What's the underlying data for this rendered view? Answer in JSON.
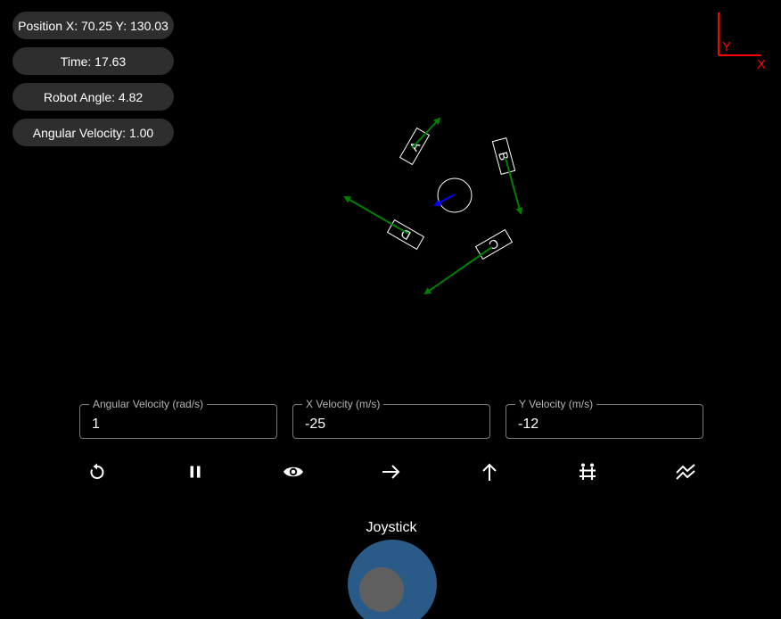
{
  "status": {
    "position": "Position X: 70.25 Y: 130.03",
    "time": "Time: 17.63",
    "robot_angle": "Robot Angle: 4.82",
    "angular_velocity": "Angular Velocity: 1.00"
  },
  "axes_indicator": {
    "y_label": "Y",
    "x_label": "X",
    "color": "#ff0000"
  },
  "robot": {
    "body_color": "#ffffff",
    "heading_color": "#0000ff",
    "vector_color": "#008000",
    "wheels": [
      {
        "label": "A"
      },
      {
        "label": "B"
      },
      {
        "label": "C"
      },
      {
        "label": "D"
      }
    ]
  },
  "controls": {
    "angular_velocity": {
      "label": "Angular Velocity (rad/s)",
      "value": "1"
    },
    "x_velocity": {
      "label": "X Velocity (m/s)",
      "value": "-25"
    },
    "y_velocity": {
      "label": "Y Velocity (m/s)",
      "value": "-12"
    }
  },
  "toolbar": [
    {
      "name": "reset-icon"
    },
    {
      "name": "pause-icon"
    },
    {
      "name": "eye-icon"
    },
    {
      "name": "arrow-right-icon"
    },
    {
      "name": "arrow-up-icon"
    },
    {
      "name": "strafe-icon"
    },
    {
      "name": "trajectory-icon"
    }
  ],
  "joystick": {
    "title": "Joystick",
    "base_color": "#2a5a87",
    "knob_color": "#5f5f5f"
  }
}
